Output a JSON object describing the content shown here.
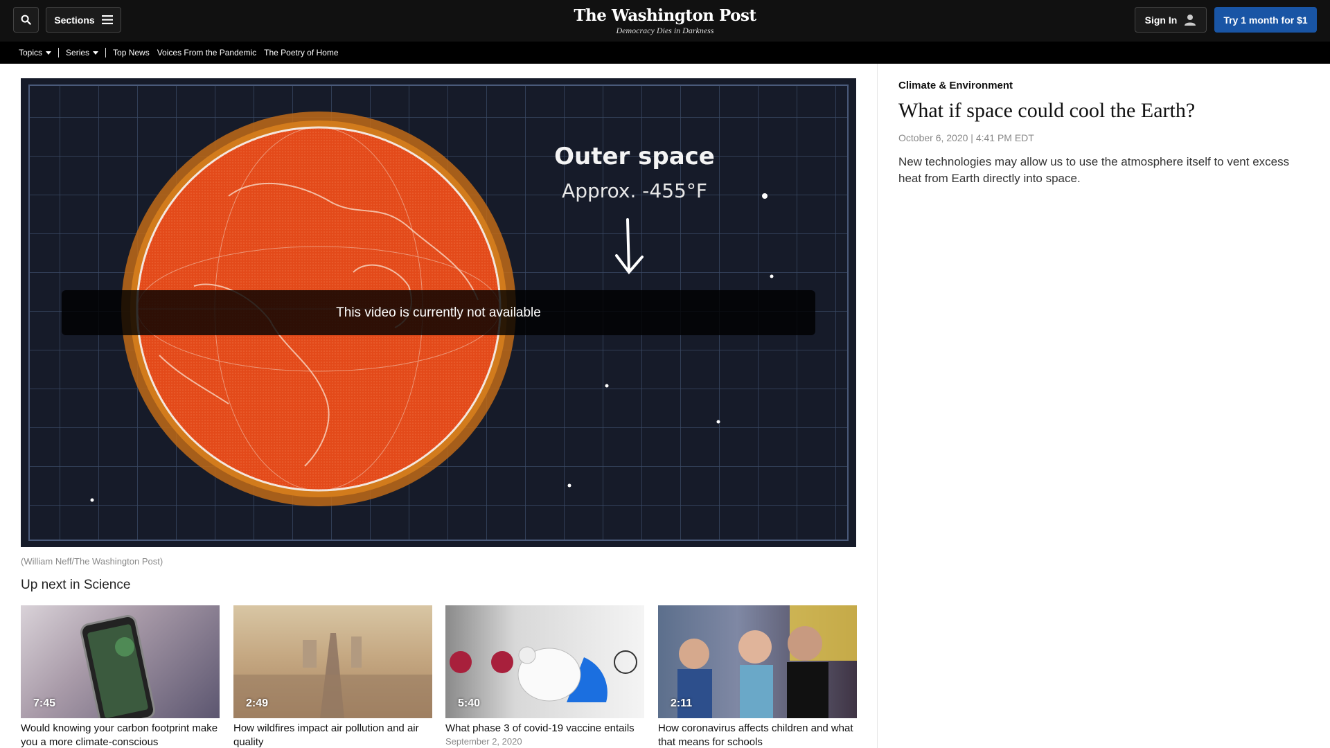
{
  "header": {
    "sections_label": "Sections",
    "brand_name": "The Washington Post",
    "brand_tagline": "Democracy Dies in Darkness",
    "signin_label": "Sign In",
    "try_label": "Try 1 month for $1"
  },
  "subnav": {
    "topics": "Topics",
    "series": "Series",
    "links": [
      "Top News",
      "Voices From the Pandemic",
      "The Poetry of Home"
    ]
  },
  "video": {
    "overlay_title": "Outer space",
    "overlay_temp": "Approx. -455°F",
    "unavailable": "This video is currently not available",
    "credit": "(William Neff/The Washington Post)"
  },
  "upnext": {
    "heading": "Up next in Science",
    "cards": [
      {
        "duration": "7:45",
        "title": "Would knowing your carbon footprint make you a more climate-conscious",
        "date": ""
      },
      {
        "duration": "2:49",
        "title": "How wildfires impact air pollution and air quality",
        "date": ""
      },
      {
        "duration": "5:40",
        "title": "What phase 3 of covid-19 vaccine entails",
        "date": "September 2, 2020"
      },
      {
        "duration": "2:11",
        "title": "How coronavirus affects children and what that means for schools",
        "date": ""
      }
    ]
  },
  "article": {
    "kicker": "Climate & Environment",
    "headline": "What if space could cool the Earth?",
    "date": "October 6, 2020 | 4:41 PM EDT",
    "blurb": "New technologies may allow us to use the atmosphere itself to vent excess heat from Earth directly into space."
  },
  "colors": {
    "topbar": "#111111",
    "accent_blue": "#1955a5",
    "earth_orange": "#e34a1a"
  }
}
